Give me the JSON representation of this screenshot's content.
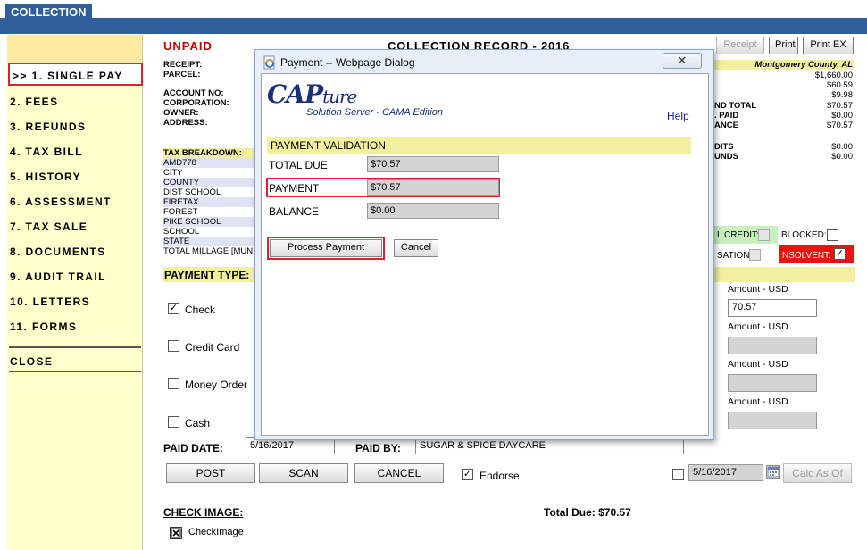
{
  "top_tab": "COLLECTION",
  "sidebar": {
    "items": [
      {
        "label": ">> 1. SINGLE PAY"
      },
      {
        "label": "2. FEES"
      },
      {
        "label": "3. REFUNDS"
      },
      {
        "label": "4. TAX BILL"
      },
      {
        "label": "5. HISTORY"
      },
      {
        "label": "6. ASSESSMENT"
      },
      {
        "label": "7. TAX SALE"
      },
      {
        "label": "8. DOCUMENTS"
      },
      {
        "label": "9. AUDIT TRAIL"
      },
      {
        "label": "10. LETTERS"
      },
      {
        "label": "11. FORMS"
      },
      {
        "label": "CLOSE"
      }
    ]
  },
  "record": {
    "status": "UNPAID",
    "title": "COLLECTION RECORD - 2016",
    "buttons": {
      "receipt": "Receipt",
      "print": "Print",
      "print_ex": "Print EX"
    },
    "county": "Montgomery County, AL",
    "left_labels": [
      "RECEIPT:",
      "PARCEL:",
      "ACCOUNT NO:",
      "CORPORATION:",
      "OWNER:",
      "ADDRESS:"
    ],
    "tax_breakdown_label": "TAX BREAKDOWN:",
    "tax_items": [
      "AMD778",
      "CITY",
      "COUNTY",
      "DIST SCHOOL",
      "FIRETAX",
      "FOREST",
      "PIKE SCHOOL",
      "SCHOOL",
      "STATE",
      "TOTAL MILLAGE [MUN"
    ],
    "right_values": [
      "$1,660.00",
      "$60.59",
      "$9.98",
      "$70.57",
      "$0.00",
      "$70.57",
      "$0.00",
      "$0.00"
    ],
    "right_labels": [
      "ND TOTAL",
      ". PAID",
      "ANCE",
      "DITS",
      "UNDS"
    ],
    "credit_label": "L CREDIT:",
    "blocked_label": "BLOCKED:",
    "sation_label": "SATION:",
    "insolvent_label": "NSOLVENT:",
    "payment_type_label": "PAYMENT TYPE:",
    "amount_label": "Amount - USD",
    "payment_methods": [
      {
        "label": "Check",
        "checked": true,
        "amount": "70.57"
      },
      {
        "label": "Credit Card",
        "checked": false,
        "amount": ""
      },
      {
        "label": "Money Order",
        "checked": false,
        "amount": ""
      },
      {
        "label": "Cash",
        "checked": false,
        "amount": ""
      }
    ],
    "paid_date_label": "PAID DATE:",
    "paid_date": "5/16/2017",
    "paid_by_label": "PAID BY:",
    "paid_by": "SUGAR & SPICE DAYCARE",
    "actions": {
      "post": "POST",
      "scan": "SCAN",
      "cancel": "CANCEL"
    },
    "endorse_label": "Endorse",
    "calc_date": "5/16/2017",
    "calc_as_of": "Calc As Of",
    "check_image_label": "CHECK IMAGE:",
    "check_image_item": "CheckImage",
    "total_due_text": "Total Due: $70.57"
  },
  "dialog": {
    "title": "Payment -- Webpage Dialog",
    "logo_main": "CAP",
    "logo_script": "ture",
    "logo_sub": "Solution Server - CAMA Edition",
    "help": "Help",
    "section": "PAYMENT VALIDATION",
    "fields": [
      {
        "label": "TOTAL DUE",
        "value": "$70.57"
      },
      {
        "label": "PAYMENT",
        "value": "$70.57"
      },
      {
        "label": "BALANCE",
        "value": "$0.00"
      }
    ],
    "process_button": "Process Payment",
    "cancel_button": "Cancel"
  },
  "colors": {
    "accent_blue": "#2f5f9b",
    "highlight_red": "#d9232d",
    "band_yellow": "#f2ef9e",
    "sidebar_bg": "#ffffcc"
  }
}
